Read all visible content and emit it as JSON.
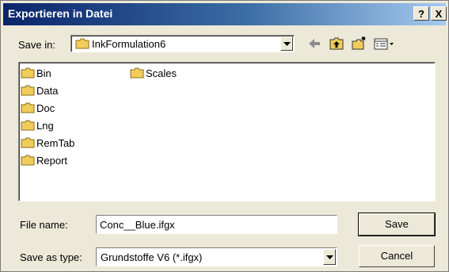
{
  "window": {
    "title": "Exportieren in Datei",
    "help_glyph": "?",
    "close_glyph": "X"
  },
  "save_in": {
    "label": "Save in:",
    "value": "InkFormulation6"
  },
  "toolbar": {
    "icons": [
      "back-arrow-icon",
      "up-folder-icon",
      "new-folder-icon",
      "view-menu-icon"
    ]
  },
  "files": [
    {
      "name": "Bin"
    },
    {
      "name": "Data"
    },
    {
      "name": "Doc"
    },
    {
      "name": "Lng"
    },
    {
      "name": "RemTab"
    },
    {
      "name": "Report"
    },
    {
      "name": "Scales"
    }
  ],
  "file_name": {
    "label": "File name:",
    "value": "Conc__Blue.ifgx"
  },
  "save_as_type": {
    "label": "Save as type:",
    "value": "Grundstoffe V6 (*.ifgx)"
  },
  "buttons": {
    "save": "Save",
    "cancel": "Cancel"
  },
  "colors": {
    "dialog_bg": "#ece9d8",
    "title_gradient_start": "#0a246a",
    "folder": "#f0cc5a"
  }
}
